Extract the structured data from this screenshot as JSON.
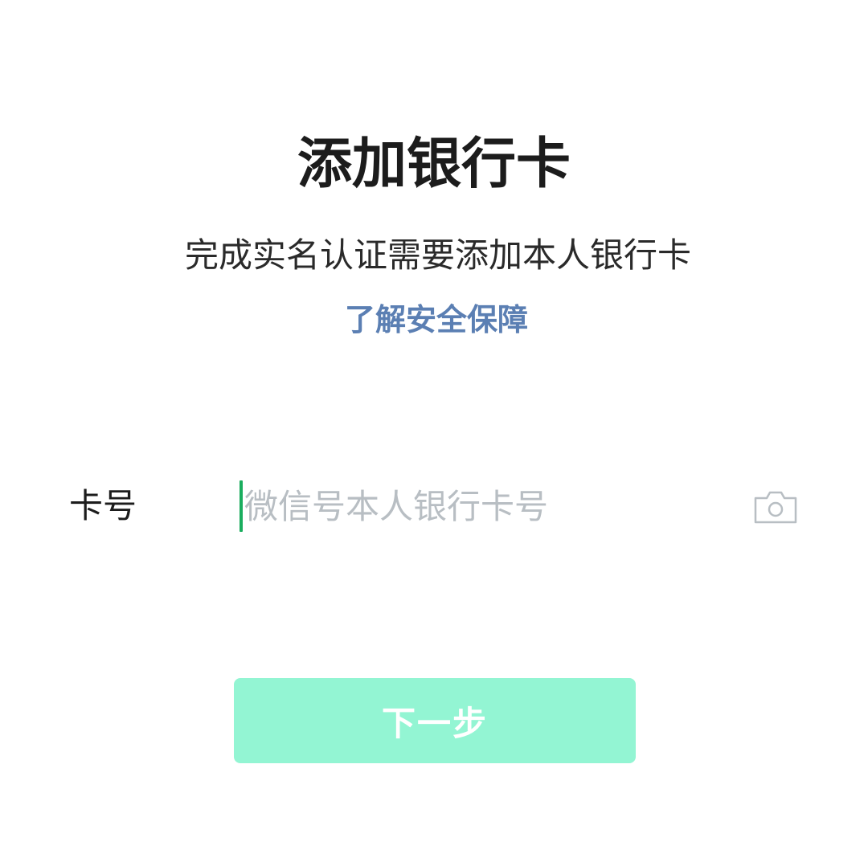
{
  "header": {
    "title": "添加银行卡",
    "subtitle": "完成实名认证需要添加本人银行卡",
    "security_link": "了解安全保障"
  },
  "form": {
    "card_label": "卡号",
    "card_input_value": "",
    "card_input_placeholder": "微信号本人银行卡号",
    "scan_icon": "camera-icon"
  },
  "actions": {
    "next_label": "下一步"
  },
  "colors": {
    "link": "#5b7fb3",
    "caret": "#1aad5e",
    "button_bg": "#93f5d3",
    "button_text": "#ffffff",
    "placeholder": "#b8bec3"
  }
}
